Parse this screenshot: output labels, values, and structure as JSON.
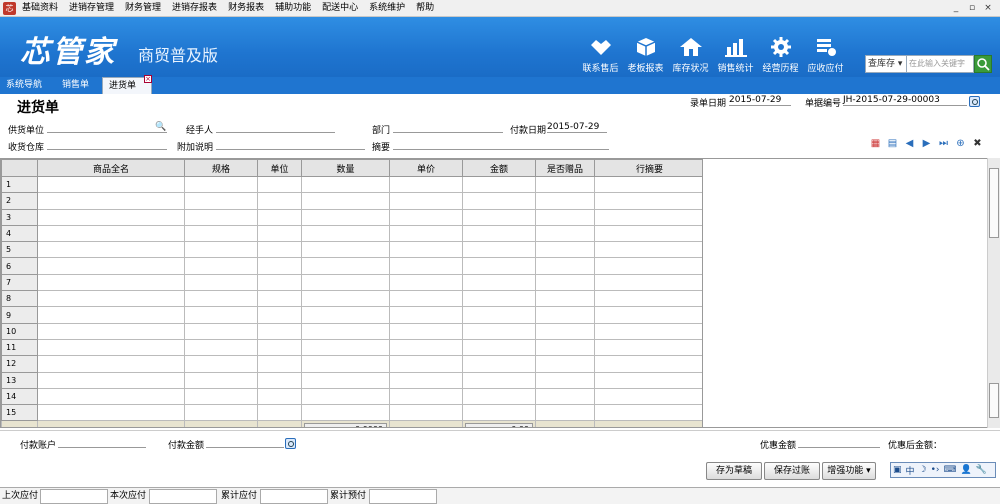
{
  "app": {
    "icon_text": "芯"
  },
  "menu": [
    "基础资料",
    "进销存管理",
    "财务管理",
    "进销存报表",
    "财务报表",
    "辅助功能",
    "配送中心",
    "系统维护",
    "帮助"
  ],
  "window_controls": [
    "_",
    "▫",
    "×"
  ],
  "brand": {
    "logo": "芯管家",
    "edition": "商贸普及版"
  },
  "toolbar": [
    {
      "label": "联系售后",
      "icon": "handshake-icon"
    },
    {
      "label": "老板报表",
      "icon": "cube-icon"
    },
    {
      "label": "库存状况",
      "icon": "home-icon"
    },
    {
      "label": "销售统计",
      "icon": "bar-chart-icon"
    },
    {
      "label": "经营历程",
      "icon": "gear-icon"
    },
    {
      "label": "应收应付",
      "icon": "list-check-icon"
    }
  ],
  "search": {
    "scope": "查库存",
    "placeholder": "在此输入关键字"
  },
  "tabs": [
    "系统导航",
    "销售单",
    "进货单"
  ],
  "form": {
    "title": "进货单",
    "entry_date_label": "录单日期",
    "entry_date": "2015-07-29",
    "doc_no_label": "单据编号",
    "doc_no": "JH-2015-07-29-00003",
    "supplier_label": "供货单位",
    "handler_label": "经手人",
    "dept_label": "部门",
    "pay_date_label": "付款日期",
    "pay_date": "2015-07-29",
    "warehouse_label": "收货仓库",
    "note_label": "附加说明",
    "summary_label": "摘要"
  },
  "row_icons": [
    "add-row-icon",
    "delete-row-icon",
    "arrow-left-icon",
    "arrow-right-icon",
    "last-icon",
    "zoom-icon",
    "tools-icon"
  ],
  "table": {
    "columns": [
      "",
      "商品全名",
      "规格",
      "单位",
      "数量",
      "单价",
      "金额",
      "是否赠品",
      "行摘要"
    ],
    "rows": [
      "1",
      "2",
      "3",
      "4",
      "5",
      "6",
      "7",
      "8",
      "9",
      "10",
      "11",
      "12",
      "13",
      "14",
      "15"
    ],
    "total_qty": "0.0000",
    "total_amount": "0.00"
  },
  "footer": {
    "pay_account_label": "付款账户",
    "pay_amount_label": "付款金额",
    "discount_label": "优惠金额",
    "after_discount_label": "优惠后金额："
  },
  "buttons": {
    "draft": "存为草稿",
    "save": "保存过账",
    "enhance": "增强功能"
  },
  "ime": [
    "中",
    "☽",
    "•›",
    "⌨",
    "👤",
    "🔧"
  ],
  "status": [
    "上次应付",
    "本次应付",
    "累计应付",
    "累计预付"
  ]
}
